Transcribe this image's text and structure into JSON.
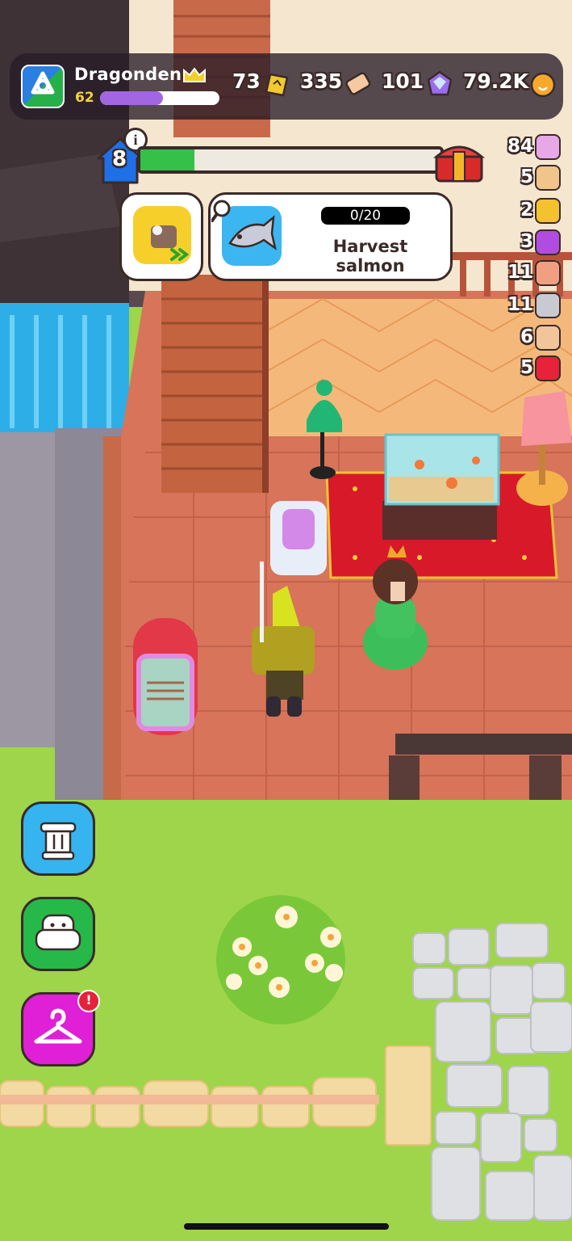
{
  "player": {
    "name": "Dragonden",
    "level": "62",
    "xp_fraction": 0.53
  },
  "currencies": [
    {
      "icon": "ticket-icon",
      "value": "73"
    },
    {
      "icon": "scroll-icon",
      "value": "335"
    },
    {
      "icon": "gem-icon",
      "value": "101"
    },
    {
      "icon": "coin-icon",
      "value": "79.2K"
    }
  ],
  "house": {
    "level": "8",
    "progress_fraction": 0.18
  },
  "quest": {
    "progress": "0/20",
    "title": "Harvest salmon"
  },
  "resources": [
    {
      "icon": "shell-icon",
      "value": "84"
    },
    {
      "icon": "map-icon",
      "value": "5"
    },
    {
      "icon": "gear-icon",
      "value": "2"
    },
    {
      "icon": "lightning-icon",
      "value": "3"
    },
    {
      "icon": "rope-icon",
      "value": "11"
    },
    {
      "icon": "metal-bar-icon",
      "value": "11"
    },
    {
      "icon": "bone-icon",
      "value": "6"
    },
    {
      "icon": "red-crystal-icon",
      "value": "5"
    }
  ],
  "side_buttons": [
    {
      "name": "museum-button",
      "icon": "pillar-icon",
      "color": "#35b4f0"
    },
    {
      "name": "furniture-button",
      "icon": "armchair-icon",
      "color": "#27b84a"
    },
    {
      "name": "wardrobe-button",
      "icon": "hanger-icon",
      "color": "#e020d6"
    }
  ],
  "wardrobe_notification": "!",
  "colors": {
    "xp": "#a266e0",
    "level_fill": "#35c04a",
    "outline": "#3a2a28"
  }
}
